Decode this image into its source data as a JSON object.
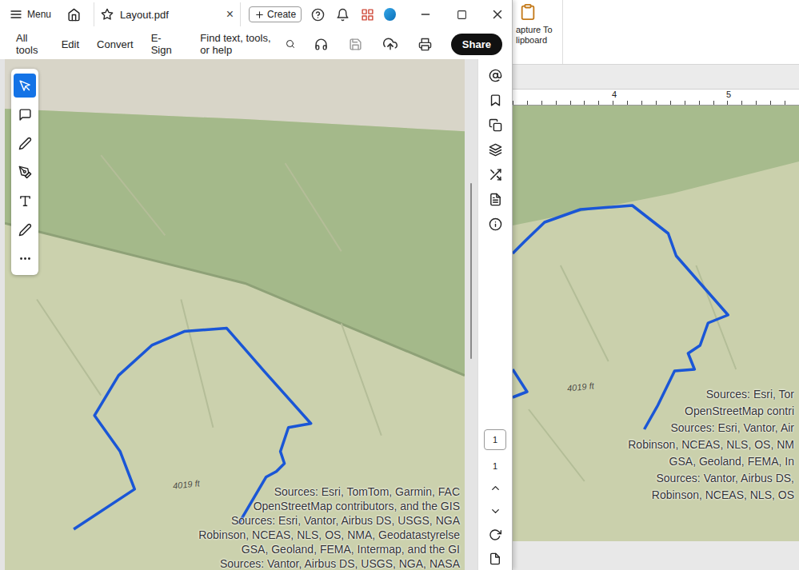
{
  "acrobat": {
    "menu": "Menu",
    "tab": {
      "title": "Layout.pdf",
      "close": "×"
    },
    "create": "Create",
    "toolbar": [
      "All tools",
      "Edit",
      "Convert",
      "E-Sign"
    ],
    "search": "Find text, tools, or help",
    "share": "Share",
    "tools": [
      {
        "selected": true
      },
      {
        "selected": false
      },
      {
        "selected": false
      },
      {
        "selected": false
      },
      {
        "selected": false
      },
      {
        "selected": false
      },
      {
        "selected": false
      }
    ],
    "page": {
      "current": "1",
      "total": "1"
    },
    "map": {
      "elevation_label": "4019 ft",
      "attribution": [
        "Sources:  Esri, TomTom, Garmin, FAC",
        "OpenStreetMap contributors, and the GIS",
        "Sources: Esri, Vantor, Airbus DS, USGS, NGA",
        "Robinson, NCEAS, NLS, OS, NMA, Geodatastyrelse",
        "GSA, Geoland, FEMA, Intermap, and the GI",
        "Sources: Vantor, Airbus DS, USGS, NGA, NASA"
      ]
    }
  },
  "background_app": {
    "ribbon_button": [
      "apture To",
      "lipboard"
    ],
    "ruler": [
      "4",
      "5"
    ],
    "map": {
      "elevation_label": "4019 ft",
      "attribution": [
        "Sources:  Esri, Tor",
        "OpenStreetMap contri",
        "Sources: Esri, Vantor, Air",
        "Robinson, NCEAS, NLS, OS, NM",
        "GSA, Geoland, FEMA, In",
        "Sources: Vantor, Airbus DS,",
        "Robinson, NCEAS, NLS, OS"
      ]
    }
  }
}
